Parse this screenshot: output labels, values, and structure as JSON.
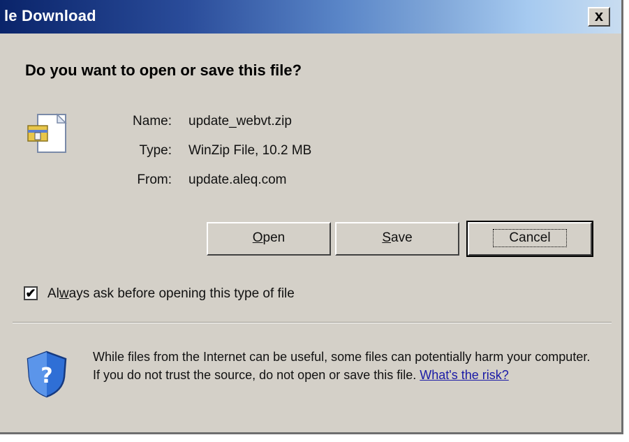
{
  "window": {
    "title": "le Download",
    "close_glyph": "x"
  },
  "dialog": {
    "question": "Do you want to open or save this file?",
    "file_icon": "zip-file-icon",
    "file": {
      "name_label": "Name:",
      "name_value": "update_webvt.zip",
      "type_label": "Type:",
      "type_value": "WinZip File, 10.2 MB",
      "from_label": "From:",
      "from_value": "update.aleq.com"
    },
    "buttons": {
      "open_label": "Open",
      "open_mnemonic": "O",
      "open_rest": "pen",
      "save_label": "Save",
      "save_mnemonic": "S",
      "save_rest": "ave",
      "cancel_label": "Cancel"
    },
    "always_ask": {
      "checked": true,
      "check_glyph": "✔",
      "label_pre": "Al",
      "label_mnemonic": "w",
      "label_post": "ays ask before opening this type of file"
    },
    "warning": {
      "icon": "shield-question-icon",
      "text": "While files from the Internet can be useful, some files can potentially harm your computer. If you do not trust the source, do not open or save this file. ",
      "link_text": "What's the risk?"
    }
  },
  "colors": {
    "dialog_bg": "#d4d0c8",
    "title_start": "#0a246a",
    "title_end": "#c8dcf0",
    "link": "#1a1aa6"
  }
}
